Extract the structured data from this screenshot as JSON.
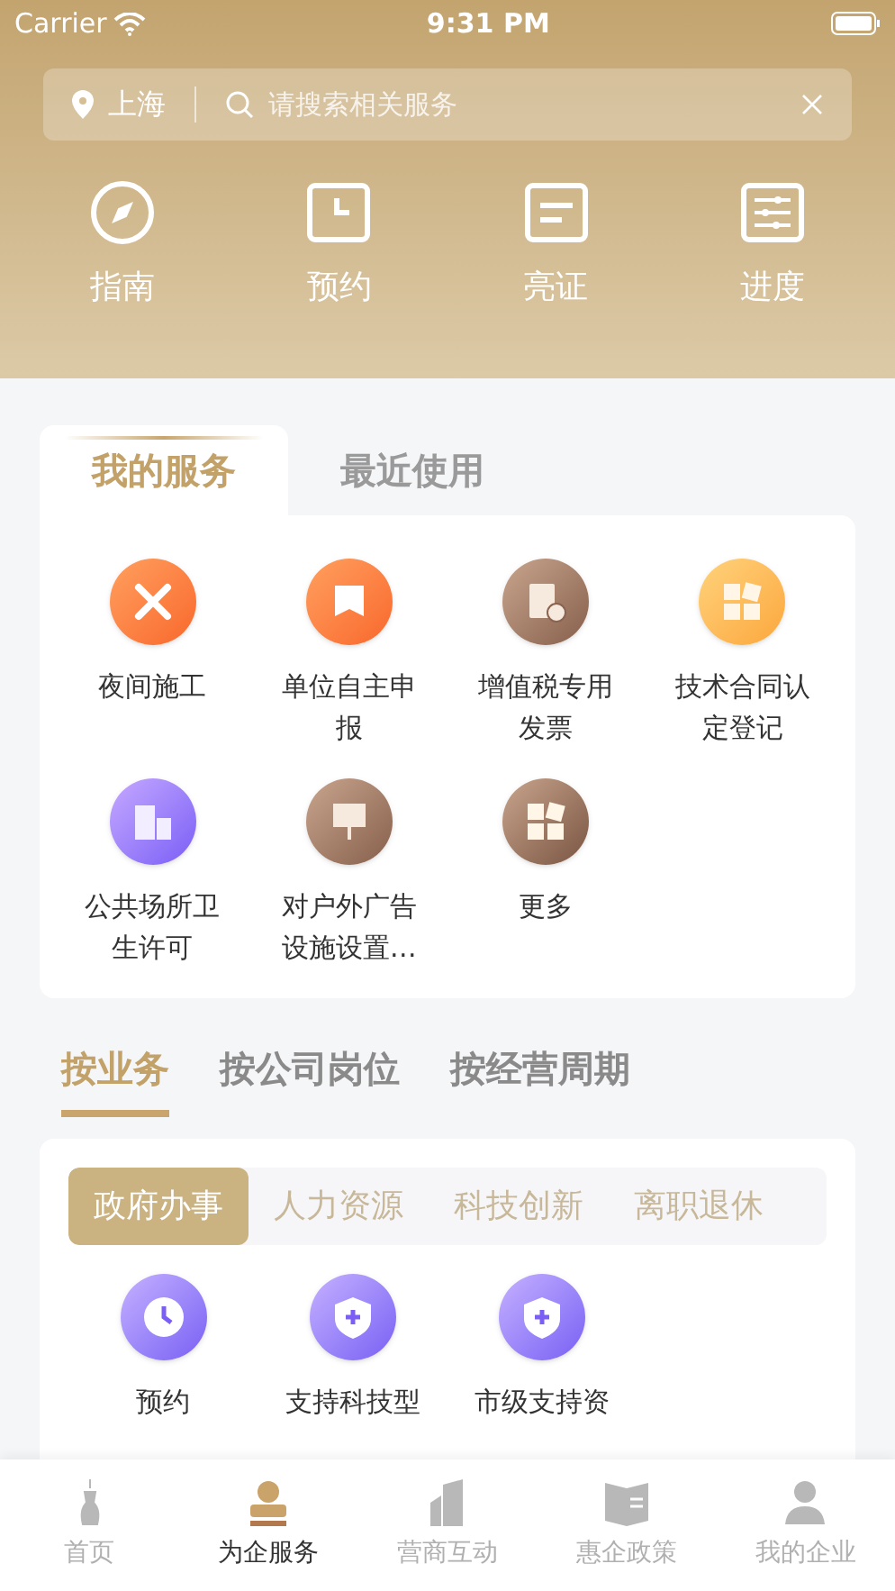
{
  "status_bar": {
    "carrier": "Carrier",
    "time": "9:31 PM"
  },
  "search": {
    "city": "上海",
    "placeholder": "请搜索相关服务"
  },
  "quick_actions": [
    {
      "label": "指南"
    },
    {
      "label": "预约"
    },
    {
      "label": "亮证"
    },
    {
      "label": "进度"
    }
  ],
  "service_tabs": [
    {
      "label": "我的服务",
      "selected": true
    },
    {
      "label": "最近使用",
      "selected": false
    }
  ],
  "services": [
    {
      "label": "夜间施工"
    },
    {
      "label": "单位自主申报"
    },
    {
      "label": "增值税专用发票"
    },
    {
      "label": "技术合同认定登记"
    },
    {
      "label": "公共场所卫生许可"
    },
    {
      "label": "对户外广告设施设置…"
    },
    {
      "label": "更多"
    }
  ],
  "category_tabs": [
    {
      "label": "按业务",
      "selected": true
    },
    {
      "label": "按公司岗位",
      "selected": false
    },
    {
      "label": "按经营周期",
      "selected": false
    }
  ],
  "sub_tabs": [
    {
      "label": "政府办事",
      "selected": true
    },
    {
      "label": "人力资源",
      "selected": false
    },
    {
      "label": "科技创新",
      "selected": false
    },
    {
      "label": "离职退休",
      "selected": false
    }
  ],
  "business_items": [
    {
      "label": "预约"
    },
    {
      "label": "支持科技型"
    },
    {
      "label": "市级支持资"
    }
  ],
  "bottom_nav": [
    {
      "label": "首页",
      "selected": false
    },
    {
      "label": "为企服务",
      "selected": true
    },
    {
      "label": "营商互动",
      "selected": false
    },
    {
      "label": "惠企政策",
      "selected": false
    },
    {
      "label": "我的企业",
      "selected": false
    }
  ]
}
